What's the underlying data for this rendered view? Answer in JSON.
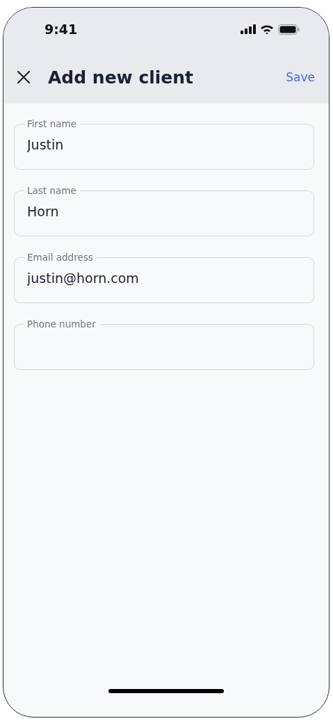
{
  "status_bar": {
    "time": "9:41"
  },
  "header": {
    "title": "Add new client",
    "action": "Save"
  },
  "fields": [
    {
      "label": "First name",
      "value": "Justin"
    },
    {
      "label": "Last name",
      "value": "Horn"
    },
    {
      "label": "Email address",
      "value": "justin@horn.com"
    },
    {
      "label": "Phone number"
    }
  ]
}
